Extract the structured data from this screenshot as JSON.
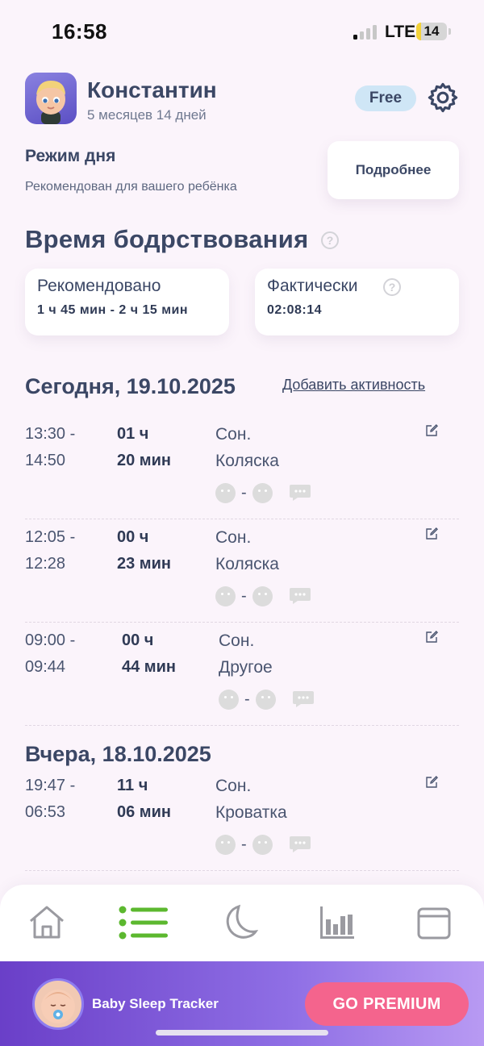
{
  "status_bar": {
    "time": "16:58",
    "network": "LTE",
    "battery": "14"
  },
  "profile": {
    "name": "Константин",
    "age": "5 месяцев 14 дней",
    "plan_badge": "Free"
  },
  "schedule": {
    "title": "Режим дня",
    "subtitle": "Рекомендован для вашего ребёнка",
    "details_button": "Подробнее"
  },
  "wake_time": {
    "title": "Время бодрствования",
    "recommended_label": "Рекомендовано",
    "recommended_value": "1 ч 45 мин - 2 ч 15 мин",
    "actual_label": "Фактически",
    "actual_value": "02:08:14"
  },
  "today": {
    "title": "Сегодня, 19.10.2025",
    "add_activity": "Добавить активность",
    "entries": [
      {
        "time_start": "13:30 -",
        "time_end": "14:50",
        "dur_h": "01 ч",
        "dur_m": "20 мин",
        "kind": "Сон.",
        "place": "Коляска"
      },
      {
        "time_start": "12:05 -",
        "time_end": "12:28",
        "dur_h": "00 ч",
        "dur_m": "23 мин",
        "kind": "Сон.",
        "place": "Коляска"
      },
      {
        "time_start": "09:00 -",
        "time_end": "09:44",
        "dur_h": "00 ч",
        "dur_m": "44 мин",
        "kind": "Сон.",
        "place": "Другое"
      }
    ]
  },
  "yesterday": {
    "title": "Вчера, 18.10.2025",
    "entries": [
      {
        "time_start": "19:47 -",
        "time_end": "06:53",
        "dur_h": "11 ч",
        "dur_m": "06 мин",
        "kind": "Сон.",
        "place": "Кроватка"
      }
    ]
  },
  "nav": {
    "items": [
      "home-icon",
      "list-icon",
      "moon-icon",
      "stats-icon",
      "calendar-icon"
    ],
    "active": "list-icon",
    "active_color": "#5cb82f",
    "inactive_color": "#9a9aa0"
  },
  "banner": {
    "app_name": "Baby Sleep Tracker",
    "button": "GO PREMIUM"
  },
  "colors": {
    "accent_pink": "#f4648d",
    "banner_purple": "#6a3fc8",
    "text": "#3b4765"
  }
}
